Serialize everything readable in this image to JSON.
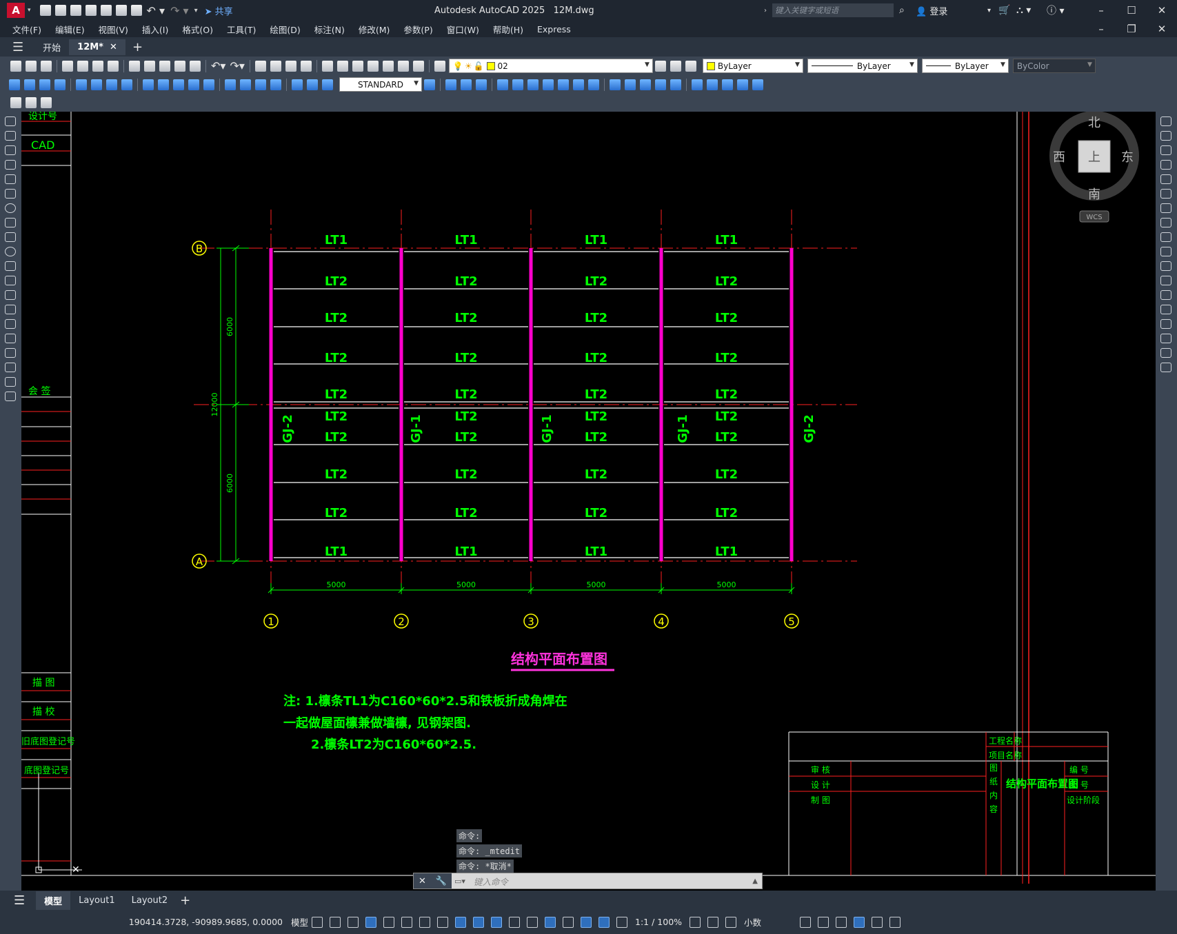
{
  "app": {
    "title": "Autodesk AutoCAD 2025",
    "filename": "12M.dwg",
    "share": "共享",
    "search_placeholder": "键入关键字或短语",
    "login": "登录",
    "logo": "A"
  },
  "menu": [
    "文件(F)",
    "编辑(E)",
    "视图(V)",
    "插入(I)",
    "格式(O)",
    "工具(T)",
    "绘图(D)",
    "标注(N)",
    "修改(M)",
    "参数(P)",
    "窗口(W)",
    "帮助(H)",
    "Express"
  ],
  "tabs": {
    "start": "开始",
    "active": "12M*"
  },
  "toolbar": {
    "layer": "02",
    "color": "ByLayer",
    "linetype": "ByLayer",
    "lineweight": "ByLayer",
    "plotstyle": "ByColor",
    "dimstyle": "STANDARD"
  },
  "viewcube": {
    "north": "北",
    "south": "南",
    "east": "东",
    "west": "西",
    "top": "上",
    "wcs": "WCS"
  },
  "drawing": {
    "title": "结构平面布置图",
    "grid_rows": [
      "B",
      "A"
    ],
    "grid_cols": [
      "1",
      "2",
      "3",
      "4",
      "5"
    ],
    "dim_spacing": "5000",
    "dim_overall": "12000",
    "dim_half": "6000",
    "purlin_edge": "LT1",
    "purlin_mid": "LT2",
    "frame_outer": "GJ-2",
    "frame_inner": "GJ-1",
    "notes": [
      "注: 1.檩条TL1为C160*60*2.5和铁板折成角焊在",
      "一起做屋面檩兼做墙檩, 见钢架图.",
      "2.檩条LT2为C160*60*2.5."
    ],
    "left_border": [
      "设计号",
      "CAD",
      "会 签",
      "描 图",
      "描 校",
      "旧底图登记号",
      "底图登记号"
    ],
    "titleblock": {
      "project_name": "工程名称",
      "item_name": "项目名称",
      "review": "审 核",
      "design": "设 计",
      "draw": "制 图",
      "content_label": "图纸内容",
      "content": "结构平面布置图",
      "num": "编 号",
      "drawing_no": "图 号",
      "stage": "设计阶段"
    }
  },
  "command": {
    "history": [
      "命令:",
      "命令: _mtedit",
      "命令: *取消*"
    ],
    "placeholder": "键入命令"
  },
  "layout_tabs": [
    "模型",
    "Layout1",
    "Layout2"
  ],
  "status": {
    "coords": "190414.3728, -90989.9685, 0.0000",
    "model": "模型",
    "scale": "1:1 / 100%",
    "units": "小数"
  }
}
